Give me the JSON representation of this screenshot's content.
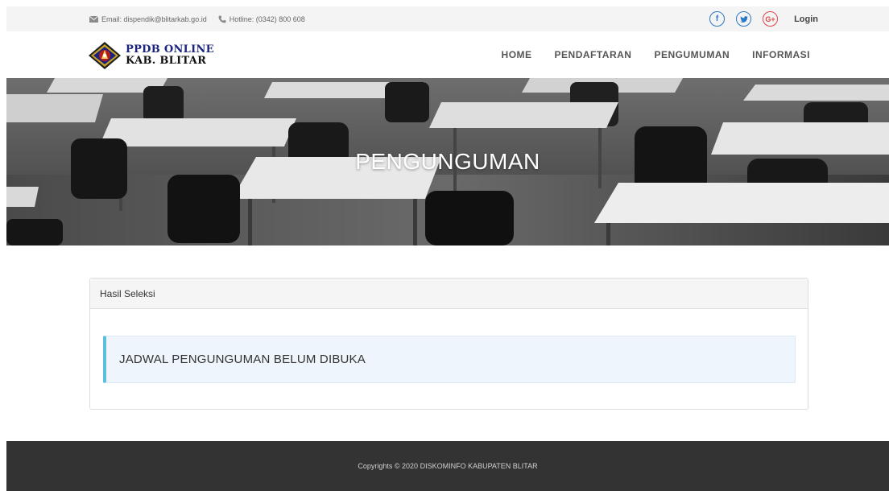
{
  "topbar": {
    "email": "Email: dispendik@blitarkab.go.id",
    "hotline": "Hotline: (0342) 800 608",
    "social": [
      {
        "name": "facebook",
        "glyph": "f"
      },
      {
        "name": "twitter",
        "glyph": "t"
      },
      {
        "name": "google-plus",
        "glyph": "G+"
      }
    ],
    "login": "Login"
  },
  "header": {
    "logo_line1": "PPDB ONLINE",
    "logo_line2": "KAB. BLITAR",
    "nav": [
      "HOME",
      "PENDAFTARAN",
      "PENGUMUMAN",
      "INFORMASI"
    ]
  },
  "banner": {
    "title": "PENGUNGUMAN"
  },
  "panel": {
    "heading": "Hasil Seleksi",
    "alert_text": "JADWAL PENGUNGUMAN BELUM DIBUKA"
  },
  "footer": {
    "copyright": "Copyrights © 2020 DISKOMINFO KABUPATEN BLITAR"
  },
  "colors": {
    "accent": "#2a79c4",
    "gplus": "#e04545",
    "alert_border": "#5bc0de",
    "footer_bg": "#333333"
  }
}
